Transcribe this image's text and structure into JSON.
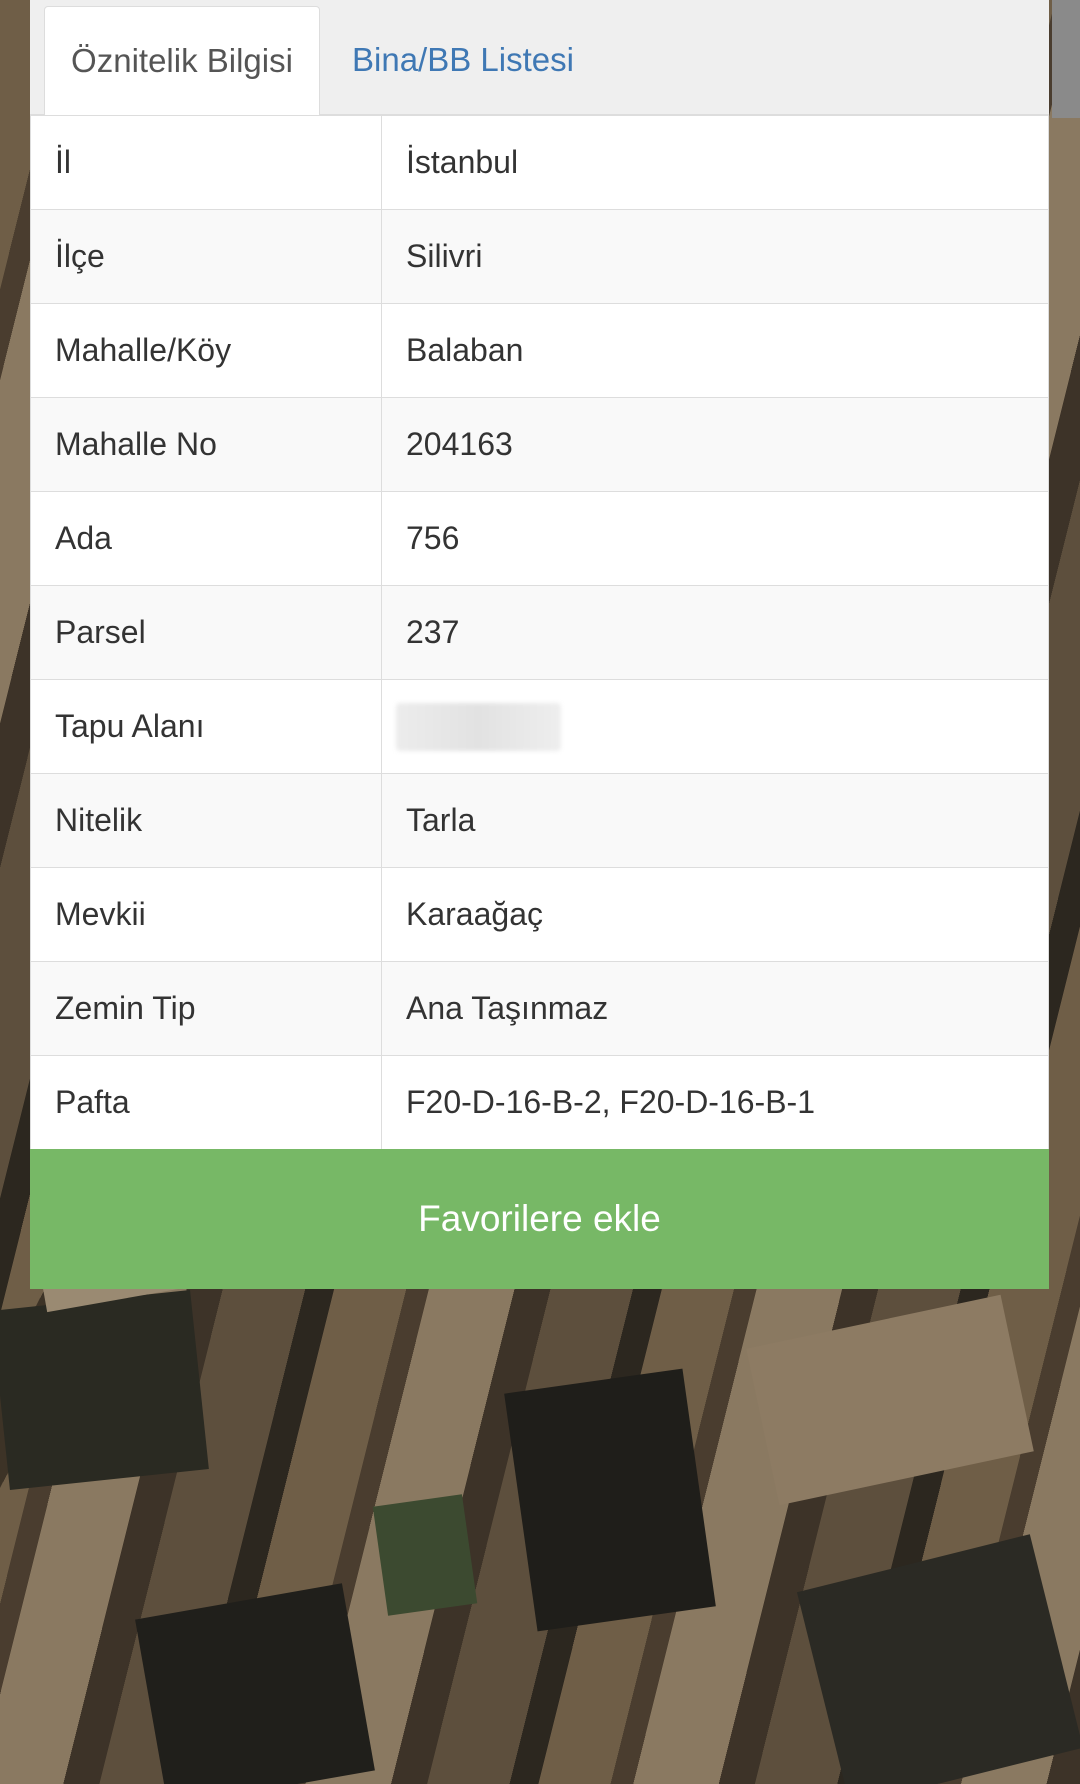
{
  "tabs": [
    {
      "label": "Öznitelik Bilgisi",
      "active": true
    },
    {
      "label": "Bina/BB Listesi",
      "active": false
    }
  ],
  "attributes": [
    {
      "key": "İl",
      "value": "İstanbul"
    },
    {
      "key": "İlçe",
      "value": "Silivri"
    },
    {
      "key": "Mahalle/Köy",
      "value": "Balaban"
    },
    {
      "key": "Mahalle No",
      "value": "204163"
    },
    {
      "key": "Ada",
      "value": "756"
    },
    {
      "key": "Parsel",
      "value": "237"
    },
    {
      "key": "Tapu Alanı",
      "value": ""
    },
    {
      "key": "Nitelik",
      "value": "Tarla"
    },
    {
      "key": "Mevkii",
      "value": "Karaağaç"
    },
    {
      "key": "Zemin Tip",
      "value": "Ana Taşınmaz"
    },
    {
      "key": "Pafta",
      "value": "F20-D-16-B-2, F20-D-16-B-1"
    }
  ],
  "favorite_button": {
    "label": "Favorilere ekle"
  },
  "colors": {
    "button": "#77b866",
    "tab_link": "#3f78b4",
    "tab_active_text": "#555555",
    "border": "#dddddd"
  }
}
